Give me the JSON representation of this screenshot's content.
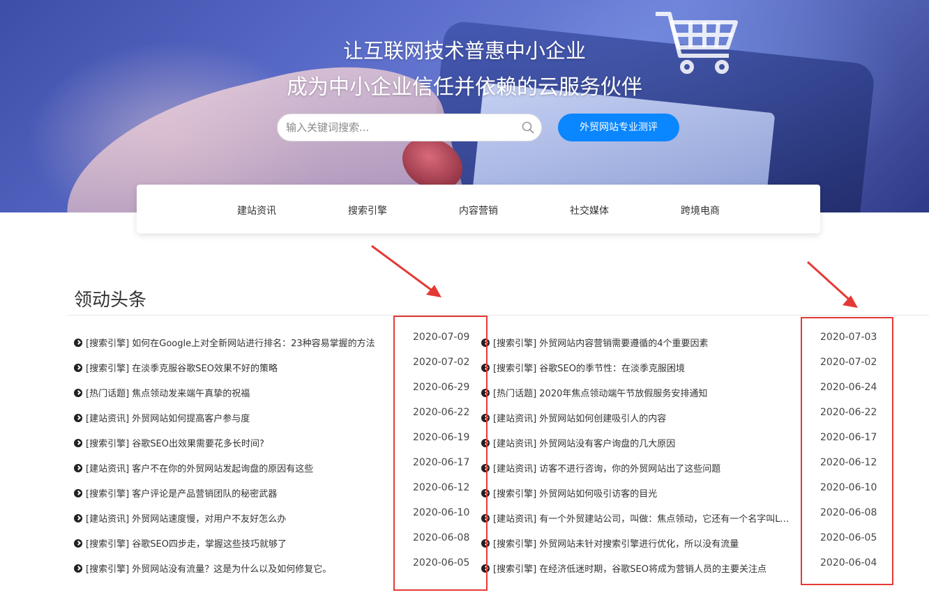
{
  "hero": {
    "title_line1": "让互联网技术普惠中小企业",
    "title_line2": "成为中小企业信任并依赖的云服务伙伴",
    "search_placeholder": "输入关键词搜索...",
    "search_icon": "search-icon",
    "eval_button": "外贸网站专业测评",
    "accent_color": "#0a86ff"
  },
  "nav": {
    "items": [
      "建站资讯",
      "搜索引擎",
      "内容营销",
      "社交媒体",
      "跨境电商"
    ]
  },
  "section": {
    "title": "领动头条"
  },
  "news_left": [
    {
      "text": "[搜索引擎] 如何在Google上对全新网站进行排名：23种容易掌握的方法",
      "date": "2020-07-09"
    },
    {
      "text": "[搜索引擎] 在淡季克服谷歌SEO效果不好的策略",
      "date": "2020-07-02"
    },
    {
      "text": "[热门话题] 焦点领动发来端午真挚的祝福",
      "date": "2020-06-29"
    },
    {
      "text": "[建站资讯] 外贸网站如何提高客户参与度",
      "date": "2020-06-22"
    },
    {
      "text": "[搜索引擎] 谷歌SEO出效果需要花多长时间?",
      "date": "2020-06-19"
    },
    {
      "text": "[建站资讯] 客户不在你的外贸网站发起询盘的原因有这些",
      "date": "2020-06-17"
    },
    {
      "text": "[搜索引擎] 客户评论是产品营销团队的秘密武器",
      "date": "2020-06-12"
    },
    {
      "text": "[建站资讯] 外贸网站速度慢，对用户不友好怎么办",
      "date": "2020-06-10"
    },
    {
      "text": "[搜索引擎] 谷歌SEO四步走，掌握这些技巧就够了",
      "date": "2020-06-08"
    },
    {
      "text": "[搜索引擎] 外贸网站没有流量？这是为什么以及如何修复它。",
      "date": "2020-06-05"
    }
  ],
  "news_right": [
    {
      "text": "[搜索引擎] 外贸网站内容营销需要遵循的4个重要因素",
      "date": "2020-07-03"
    },
    {
      "text": "[搜索引擎] 谷歌SEO的季节性：在淡季克服困境",
      "date": "2020-07-02"
    },
    {
      "text": "[热门话题] 2020年焦点领动端午节放假服务安排通知",
      "date": "2020-06-24"
    },
    {
      "text": "[建站资讯] 外贸网站如何创建吸引人的内容",
      "date": "2020-06-22"
    },
    {
      "text": "[建站资讯] 外贸网站没有客户询盘的几大原因",
      "date": "2020-06-17"
    },
    {
      "text": "[建站资讯] 访客不进行咨询，你的外贸网站出了这些问题",
      "date": "2020-06-12"
    },
    {
      "text": "[搜索引擎] 外贸网站如何吸引访客的目光",
      "date": "2020-06-10"
    },
    {
      "text": "[建站资讯] 有一个外贸建站公司，叫做：焦点领动，它还有一个名字叫LeadongSite",
      "date": "2020-06-08"
    },
    {
      "text": "[搜索引擎] 外贸网站未针对搜索引擎进行优化，所以没有流量",
      "date": "2020-06-05"
    },
    {
      "text": "[搜索引擎] 在经济低迷时期，谷歌SEO将成为营销人员的主要关注点",
      "date": "2020-06-04"
    }
  ],
  "annotation_color": "#e53935"
}
